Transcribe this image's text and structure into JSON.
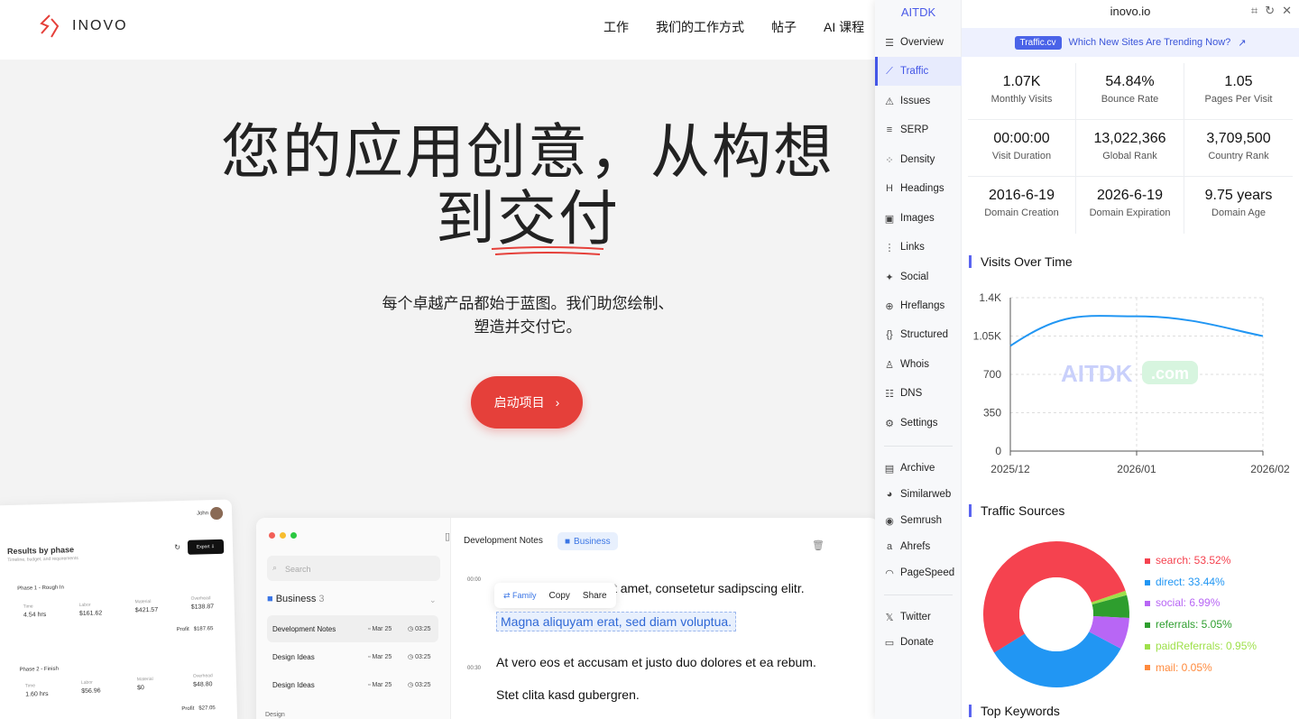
{
  "site": {
    "logo_text": "INOVO",
    "nav": [
      "工作",
      "我们的工作方式",
      "帖子",
      "AI 课程"
    ],
    "hero_line1": "您的应用创意，从构想",
    "hero_line2a": "到",
    "hero_line2b": "交付",
    "sub_line1": "每个卓越产品都始于蓝图。我们助您绘制、",
    "sub_line2": "塑造并交付它。",
    "cta": "启动项目",
    "mock_results": {
      "user": "John",
      "title": "Results by phase",
      "subtitle": "Timeline, budget, and requirements",
      "export": "Export",
      "phase1": "Phase 1 - Rough In",
      "phase2": "Phase 2 - Finish",
      "labels": [
        "Time",
        "Labor",
        "Material",
        "Overhead"
      ],
      "p1_values": [
        "4.54 hrs",
        "$161.62",
        "$421.57",
        "$138.87"
      ],
      "p2_values": [
        "1.60 hrs",
        "$56.96",
        "$0",
        "$48.80"
      ],
      "profit_label": "Profit",
      "p1_profit": "$187.65",
      "p2_profit": "$27.05"
    },
    "mock_notes": {
      "search": "Search",
      "folder": "Business",
      "folder_count": "3",
      "rows": [
        {
          "title": "Development Notes",
          "date": "Mar 25",
          "time": "03:25"
        },
        {
          "title": "Design Ideas",
          "date": "Mar 25",
          "time": "03:25"
        },
        {
          "title": "Design Ideas",
          "date": "Mar 25",
          "time": "03:25"
        }
      ],
      "section": "Design",
      "doc_title": "Development Notes",
      "doc_badge": "Business",
      "ts1": "00:00",
      "ts2": "00:30",
      "p1": "Lorem ipsum dolor sit amet, consetetur sadipscing elitr.",
      "p2": "Magna aliquyam  erat, sed diam voluptua.",
      "p3": "At vero eos et accusam et justo duo dolores et ea rebum.",
      "p4": "Stet clita kasd gubergren.",
      "pop_family": "Family",
      "pop_copy": "Copy",
      "pop_share": "Share"
    }
  },
  "ext": {
    "brand": "AITDK",
    "domain": "inovo.io",
    "menu": [
      "Overview",
      "Traffic",
      "Issues",
      "SERP",
      "Density",
      "Headings",
      "Images",
      "Links",
      "Social",
      "Hreflangs",
      "Structured",
      "Whois",
      "DNS",
      "Settings"
    ],
    "tools": [
      "Archive",
      "Similarweb",
      "Semrush",
      "Ahrefs",
      "PageSpeed"
    ],
    "extra": [
      "Twitter",
      "Donate"
    ],
    "banner_tag": "Traffic.cv",
    "banner_text": "Which New Sites Are Trending Now?",
    "stats": [
      {
        "v": "1.07K",
        "l": "Monthly Visits"
      },
      {
        "v": "54.84%",
        "l": "Bounce Rate"
      },
      {
        "v": "1.05",
        "l": "Pages Per Visit"
      },
      {
        "v": "00:00:00",
        "l": "Visit Duration"
      },
      {
        "v": "13,022,366",
        "l": "Global Rank"
      },
      {
        "v": "3,709,500",
        "l": "Country Rank"
      },
      {
        "v": "2016-6-19",
        "l": "Domain Creation"
      },
      {
        "v": "2026-6-19",
        "l": "Domain Expiration"
      },
      {
        "v": "9.75 years",
        "l": "Domain Age"
      }
    ],
    "visits_title": "Visits Over Time",
    "sources_title": "Traffic Sources",
    "keywords_title": "Top Keywords",
    "watermark_a": "AITDK",
    "watermark_b": ".com",
    "colors": {
      "accent": "#4356e6",
      "line": "#2196f3"
    }
  },
  "chart_data": [
    {
      "type": "line",
      "title": "Visits Over Time",
      "x": [
        "2025/12",
        "2026/01",
        "2026/02"
      ],
      "series": [
        {
          "values": [
            960,
            1230,
            1050
          ]
        }
      ],
      "yticks": [
        "0",
        "350",
        "700",
        "1.05K",
        "1.4K"
      ],
      "ylim": [
        0,
        1400
      ],
      "grid": true
    },
    {
      "type": "pie",
      "title": "Traffic Sources",
      "slices": [
        {
          "label": "search: 53.52%",
          "value": 53.52,
          "color": "#f5424f"
        },
        {
          "label": "direct: 33.44%",
          "value": 33.44,
          "color": "#2196f3"
        },
        {
          "label": "social: 6.99%",
          "value": 6.99,
          "color": "#b866f5"
        },
        {
          "label": "referrals: 5.05%",
          "value": 5.05,
          "color": "#2e9e2e"
        },
        {
          "label": "paidReferrals: 0.95%",
          "value": 0.95,
          "color": "#9ee04a"
        },
        {
          "label": "mail: 0.05%",
          "value": 0.05,
          "color": "#ff8a3d"
        }
      ],
      "legend": "right"
    }
  ]
}
